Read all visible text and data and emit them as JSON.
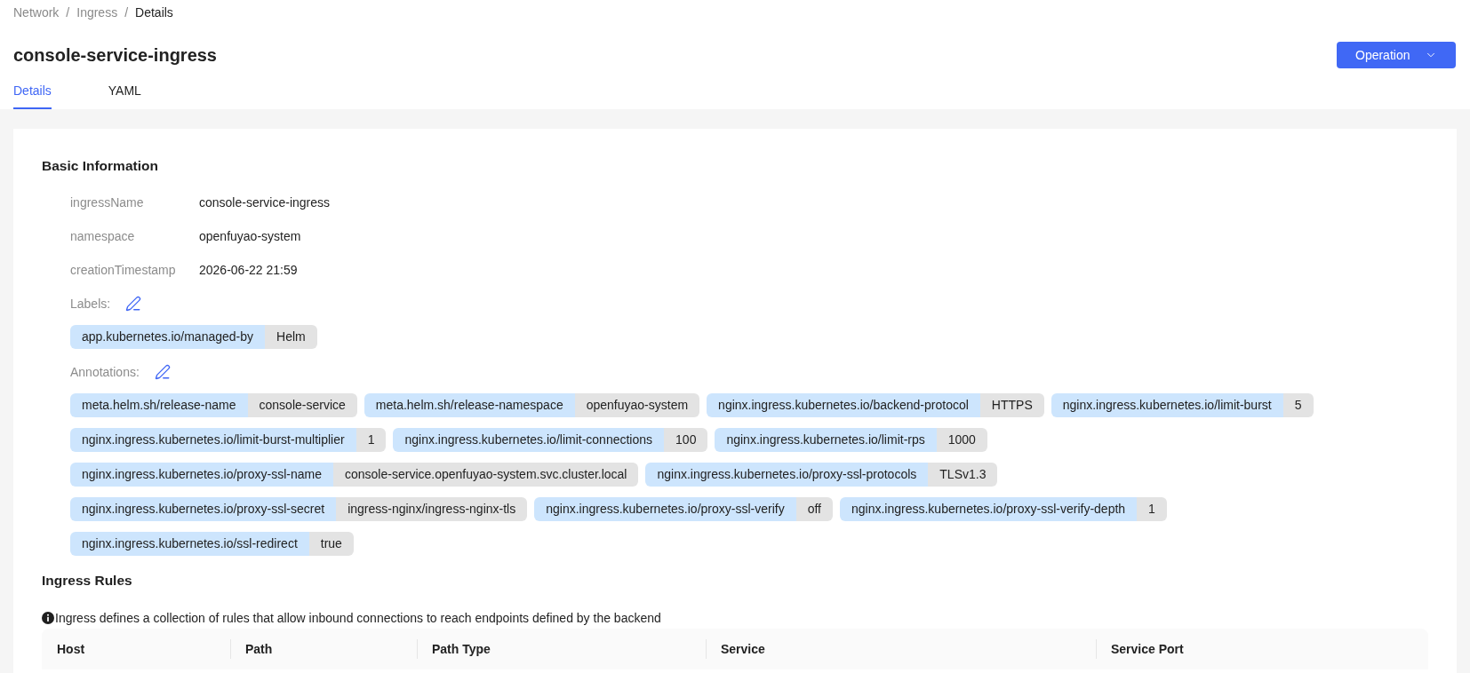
{
  "breadcrumb": [
    {
      "label": "Network",
      "current": false
    },
    {
      "separator": "/",
      "label": "Ingress",
      "current": false
    },
    {
      "separator": "/",
      "label": "Details",
      "current": true
    }
  ],
  "title": "console-service-ingress",
  "operation_button": {
    "label": "Operation"
  },
  "tabs": [
    {
      "label": "Details",
      "selected": true
    },
    {
      "label": "YAML",
      "selected": false
    }
  ],
  "basic_information": {
    "heading": "Basic Information",
    "fields": [
      {
        "label": "ingressName",
        "value": "console-service-ingress"
      },
      {
        "label": "namespace",
        "value": "openfuyao-system"
      },
      {
        "label": "creationTimestamp",
        "value": "2026-06-22 21:59"
      }
    ],
    "labels": {
      "title": "Labels:",
      "tags": [
        {
          "key": "app.kubernetes.io/managed-by",
          "value": "Helm"
        }
      ]
    },
    "annotations": {
      "title": "Annotations:",
      "tags": [
        {
          "key": "meta.helm.sh/release-name",
          "value": "console-service"
        },
        {
          "key": "meta.helm.sh/release-namespace",
          "value": "openfuyao-system"
        },
        {
          "key": "nginx.ingress.kubernetes.io/backend-protocol",
          "value": "HTTPS"
        },
        {
          "key": "nginx.ingress.kubernetes.io/limit-burst",
          "value": "5"
        },
        {
          "key": "nginx.ingress.kubernetes.io/limit-burst-multiplier",
          "value": "1"
        },
        {
          "key": "nginx.ingress.kubernetes.io/limit-connections",
          "value": "100"
        },
        {
          "key": "nginx.ingress.kubernetes.io/limit-rps",
          "value": "1000"
        },
        {
          "key": "nginx.ingress.kubernetes.io/proxy-ssl-name",
          "value": "console-service.openfuyao-system.svc.cluster.local"
        },
        {
          "key": "nginx.ingress.kubernetes.io/proxy-ssl-protocols",
          "value": "TLSv1.3"
        },
        {
          "key": "nginx.ingress.kubernetes.io/proxy-ssl-secret",
          "value": "ingress-nginx/ingress-nginx-tls"
        },
        {
          "key": "nginx.ingress.kubernetes.io/proxy-ssl-verify",
          "value": "off"
        },
        {
          "key": "nginx.ingress.kubernetes.io/proxy-ssl-verify-depth",
          "value": "1"
        },
        {
          "key": "nginx.ingress.kubernetes.io/ssl-redirect",
          "value": "true"
        }
      ]
    }
  },
  "ingress_rules": {
    "heading": "Ingress Rules",
    "info": "Ingress defines a collection of rules that allow inbound connections to reach endpoints defined by the backend",
    "table": {
      "columns": [
        "Host",
        "Path",
        "Path Type",
        "Service",
        "Service Port"
      ]
    }
  }
}
